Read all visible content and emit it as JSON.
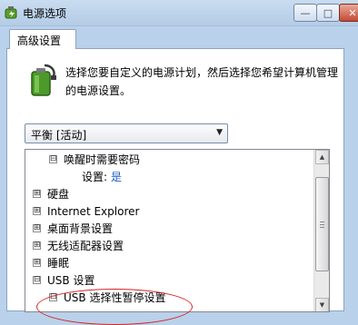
{
  "window": {
    "title": "电源选项",
    "icon": "power-options-icon",
    "buttons": {
      "minimize_icon": "minimize-icon",
      "minimize_glyph": "—",
      "maximize_icon": "maximize-icon",
      "maximize_glyph": "□",
      "close_icon": "close-icon",
      "close_glyph": "✕"
    }
  },
  "tab": {
    "label": "高级设置"
  },
  "description": "选择您要自定义的电源计划，然后选择您希望计算机管理的电源设置。",
  "plan_select": {
    "value": "平衡 [活动]",
    "arrow_glyph": "▼"
  },
  "tree": {
    "items": [
      {
        "label": "唤醒时需要密码",
        "expander": "⊟",
        "level": 1
      },
      {
        "label": "设置:",
        "value": "是",
        "level": 2
      },
      {
        "label": "硬盘",
        "expander": "⊞",
        "level": 0
      },
      {
        "label": "Internet Explorer",
        "expander": "⊞",
        "level": 0
      },
      {
        "label": "桌面背景设置",
        "expander": "⊞",
        "level": 0
      },
      {
        "label": "无线适配器设置",
        "expander": "⊞",
        "level": 0
      },
      {
        "label": "睡眠",
        "expander": "⊞",
        "level": 0
      },
      {
        "label": "USB 设置",
        "expander": "⊟",
        "level": 0
      },
      {
        "label": "USB 选择性暂停设置",
        "expander": "⊟",
        "level": 1
      }
    ],
    "scrollbar": {
      "up_glyph": "▲",
      "down_glyph": "▼"
    }
  },
  "colors": {
    "value_link": "#1f5fbf",
    "annotation": "#d62222"
  }
}
